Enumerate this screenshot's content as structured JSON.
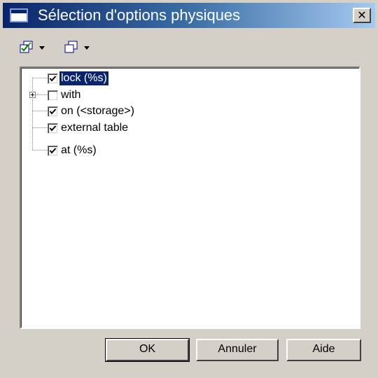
{
  "window": {
    "title": "Sélection d'options physiques",
    "close_glyph": "✕"
  },
  "toolbar": {
    "buttons": [
      {
        "icon": "select-all-icon"
      },
      {
        "icon": "deselect-all-icon"
      }
    ]
  },
  "tree": {
    "items": [
      {
        "label": "lock (%s)",
        "checked": true,
        "selected": true,
        "expandable": false
      },
      {
        "label": "with",
        "checked": false,
        "selected": false,
        "expandable": true
      },
      {
        "label": "on (<storage>)",
        "checked": true,
        "selected": false,
        "expandable": false
      },
      {
        "label": "external table",
        "checked": true,
        "selected": false,
        "expandable": false
      },
      {
        "label": "at (%s)",
        "checked": true,
        "selected": false,
        "expandable": false
      }
    ]
  },
  "buttons": {
    "ok": "OK",
    "cancel": "Annuler",
    "help": "Aide"
  }
}
